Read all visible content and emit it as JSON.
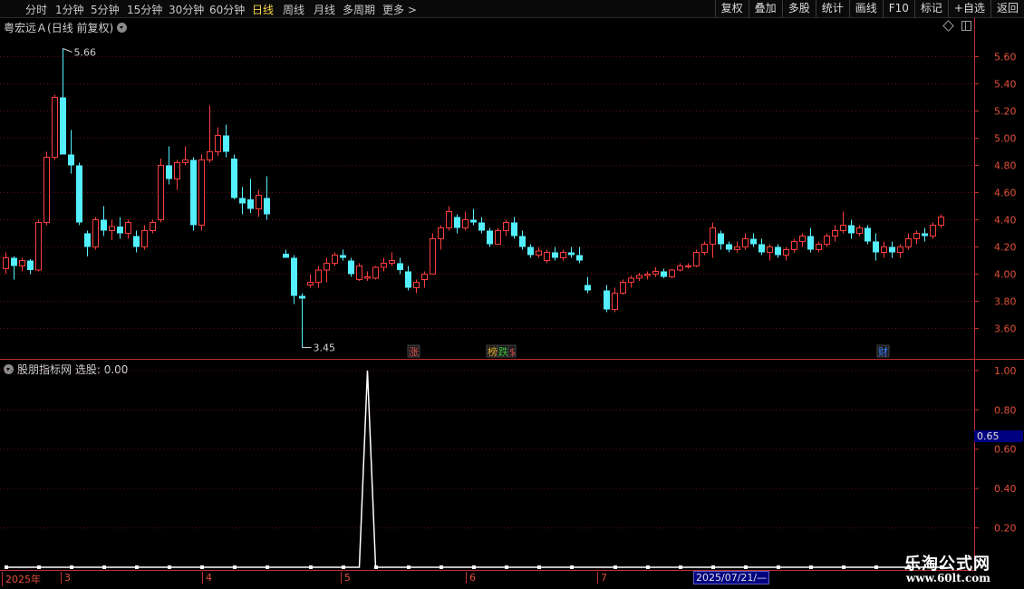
{
  "toolbar": {
    "periods": [
      "分时",
      "1分钟",
      "5分钟",
      "15分钟",
      "30分钟",
      "60分钟",
      "日线",
      "周线",
      "月线",
      "多周期",
      "更多 >"
    ],
    "active_period": "日线",
    "right": [
      "复权",
      "叠加",
      "多股",
      "统计",
      "画线",
      "F10",
      "标记",
      "+自选",
      "返回"
    ]
  },
  "main_panel": {
    "stock_name": "粤宏远Ａ",
    "mode": "(日线 前复权)",
    "ylim": [
      3.45,
      5.75
    ],
    "y_ticks": [
      "5.60",
      "5.40",
      "5.20",
      "5.00",
      "4.80",
      "4.60",
      "4.40",
      "4.20",
      "4.00",
      "3.80",
      "3.60"
    ],
    "high_label": "5.66",
    "low_label": "3.45",
    "markers": [
      {
        "text": "涨",
        "color": "#e05050"
      },
      {
        "text": "榜",
        "color": "#e0b030"
      },
      {
        "text": "跌",
        "color": "#40c040"
      },
      {
        "text": "$",
        "color": "#e05050"
      },
      {
        "text": "财",
        "color": "#4080ff"
      }
    ]
  },
  "sub_panel": {
    "indicator": "股朋指标网",
    "value_label": "选股: 0.00",
    "y_ticks": [
      "1.00",
      "0.80",
      "0.60",
      "0.40",
      "0.20"
    ],
    "cursor_value": "0.65"
  },
  "time_axis": {
    "labels": [
      "2025年",
      "3",
      "4",
      "5",
      "6",
      "7"
    ],
    "cursor_date": "2025/07/21/—"
  },
  "watermark": {
    "title": "乐淘公式网",
    "url": "www.60lt.com"
  },
  "colors": {
    "up": "#ff3d3d",
    "down": "#54f0ff",
    "axis": "#c03030",
    "background": "#000000"
  },
  "chart_data": {
    "type": "candlestick",
    "ohlc": [
      [
        4.04,
        4.16,
        4.0,
        4.12
      ],
      [
        4.12,
        4.13,
        3.96,
        4.06
      ],
      [
        4.06,
        4.12,
        4.02,
        4.1
      ],
      [
        4.1,
        4.11,
        4.0,
        4.03
      ],
      [
        4.03,
        4.4,
        4.02,
        4.38
      ],
      [
        4.38,
        4.9,
        4.36,
        4.86
      ],
      [
        4.86,
        5.32,
        4.84,
        5.3
      ],
      [
        5.3,
        5.66,
        4.9,
        4.88
      ],
      [
        4.88,
        5.06,
        4.74,
        4.8
      ],
      [
        4.8,
        4.82,
        4.36,
        4.38
      ],
      [
        4.3,
        4.32,
        4.13,
        4.2
      ],
      [
        4.2,
        4.42,
        4.18,
        4.4
      ],
      [
        4.4,
        4.5,
        4.28,
        4.32
      ],
      [
        4.32,
        4.4,
        4.25,
        4.35
      ],
      [
        4.35,
        4.42,
        4.26,
        4.3
      ],
      [
        4.3,
        4.4,
        4.26,
        4.38
      ],
      [
        4.28,
        4.32,
        4.16,
        4.2
      ],
      [
        4.2,
        4.36,
        4.18,
        4.32
      ],
      [
        4.32,
        4.4,
        4.3,
        4.38
      ],
      [
        4.4,
        4.85,
        4.38,
        4.8
      ],
      [
        4.8,
        4.94,
        4.66,
        4.7
      ],
      [
        4.7,
        4.84,
        4.62,
        4.82
      ],
      [
        4.82,
        4.94,
        4.8,
        4.84
      ],
      [
        4.84,
        4.86,
        4.32,
        4.36
      ],
      [
        4.36,
        4.88,
        4.32,
        4.84
      ],
      [
        4.84,
        5.24,
        4.82,
        4.9
      ],
      [
        4.9,
        5.08,
        4.87,
        5.02
      ],
      [
        5.02,
        5.1,
        4.86,
        4.9
      ],
      [
        4.85,
        4.88,
        4.55,
        4.56
      ],
      [
        4.56,
        4.64,
        4.44,
        4.52
      ],
      [
        4.55,
        4.7,
        4.45,
        4.48
      ],
      [
        4.48,
        4.62,
        4.42,
        4.58
      ],
      [
        4.56,
        4.72,
        4.4,
        4.44
      ],
      [
        4.15,
        4.18,
        4.12,
        4.12
      ],
      [
        4.12,
        4.14,
        3.78,
        3.84
      ],
      [
        3.84,
        3.86,
        3.46,
        3.82
      ],
      [
        3.92,
        4.0,
        3.9,
        3.94
      ],
      [
        3.94,
        4.06,
        3.9,
        4.03
      ],
      [
        4.03,
        4.12,
        3.94,
        4.08
      ],
      [
        4.08,
        4.16,
        4.06,
        4.14
      ],
      [
        4.14,
        4.18,
        4.1,
        4.12
      ],
      [
        4.1,
        4.12,
        3.98,
        4.0
      ],
      [
        3.96,
        4.08,
        3.95,
        4.06
      ],
      [
        3.97,
        4.02,
        3.95,
        3.98
      ],
      [
        3.97,
        4.06,
        3.96,
        4.05
      ],
      [
        4.05,
        4.12,
        4.02,
        4.08
      ],
      [
        4.08,
        4.16,
        4.06,
        4.1
      ],
      [
        4.08,
        4.12,
        4.0,
        4.03
      ],
      [
        4.02,
        4.06,
        3.88,
        3.9
      ],
      [
        3.9,
        3.96,
        3.86,
        3.94
      ],
      [
        3.96,
        4.02,
        3.9,
        4.0
      ],
      [
        4.0,
        4.3,
        4.18,
        4.26
      ],
      [
        4.26,
        4.36,
        4.18,
        4.34
      ],
      [
        4.34,
        4.5,
        4.32,
        4.46
      ],
      [
        4.42,
        4.44,
        4.3,
        4.34
      ],
      [
        4.34,
        4.46,
        4.32,
        4.4
      ],
      [
        4.4,
        4.48,
        4.36,
        4.38
      ],
      [
        4.38,
        4.42,
        4.3,
        4.32
      ],
      [
        4.32,
        4.34,
        4.2,
        4.22
      ],
      [
        4.22,
        4.34,
        4.22,
        4.32
      ],
      [
        4.32,
        4.4,
        4.28,
        4.38
      ],
      [
        4.38,
        4.42,
        4.26,
        4.28
      ],
      [
        4.28,
        4.32,
        4.18,
        4.2
      ],
      [
        4.2,
        4.22,
        4.12,
        4.14
      ],
      [
        4.14,
        4.2,
        4.12,
        4.17
      ],
      [
        4.1,
        4.18,
        4.08,
        4.16
      ],
      [
        4.16,
        4.2,
        4.1,
        4.12
      ],
      [
        4.12,
        4.18,
        4.1,
        4.16
      ],
      [
        4.16,
        4.2,
        4.12,
        4.14
      ],
      [
        4.14,
        4.2,
        4.08,
        4.1
      ],
      [
        3.92,
        3.98,
        3.86,
        3.88
      ],
      [
        3.88,
        3.92,
        3.72,
        3.74
      ],
      [
        3.74,
        3.9,
        3.72,
        3.86
      ],
      [
        3.86,
        3.96,
        3.85,
        3.94
      ],
      [
        3.94,
        3.99,
        3.9,
        3.97
      ],
      [
        3.97,
        4.01,
        3.95,
        3.99
      ],
      [
        3.99,
        4.02,
        3.96,
        4.0
      ],
      [
        4.0,
        4.05,
        3.98,
        4.02
      ],
      [
        4.02,
        4.04,
        3.97,
        3.98
      ],
      [
        3.98,
        4.04,
        3.97,
        4.03
      ],
      [
        4.03,
        4.08,
        4.02,
        4.06
      ],
      [
        4.06,
        4.08,
        4.04,
        4.06
      ],
      [
        4.06,
        4.18,
        4.05,
        4.16
      ],
      [
        4.16,
        4.24,
        4.14,
        4.22
      ],
      [
        4.22,
        4.38,
        4.12,
        4.34
      ],
      [
        4.3,
        4.32,
        4.18,
        4.22
      ],
      [
        4.22,
        4.24,
        4.16,
        4.18
      ],
      [
        4.18,
        4.24,
        4.16,
        4.2
      ],
      [
        4.2,
        4.3,
        4.18,
        4.26
      ],
      [
        4.26,
        4.3,
        4.2,
        4.22
      ],
      [
        4.22,
        4.26,
        4.14,
        4.16
      ],
      [
        4.16,
        4.22,
        4.1,
        4.2
      ],
      [
        4.2,
        4.22,
        4.12,
        4.14
      ],
      [
        4.14,
        4.2,
        4.1,
        4.18
      ],
      [
        4.18,
        4.26,
        4.16,
        4.24
      ],
      [
        4.24,
        4.3,
        4.2,
        4.28
      ],
      [
        4.28,
        4.34,
        4.16,
        4.18
      ],
      [
        4.18,
        4.24,
        4.16,
        4.22
      ],
      [
        4.22,
        4.3,
        4.2,
        4.28
      ],
      [
        4.28,
        4.36,
        4.24,
        4.32
      ],
      [
        4.32,
        4.46,
        4.3,
        4.36
      ],
      [
        4.36,
        4.4,
        4.26,
        4.3
      ],
      [
        4.3,
        4.36,
        4.28,
        4.34
      ],
      [
        4.34,
        4.36,
        4.22,
        4.24
      ],
      [
        4.24,
        4.3,
        4.1,
        4.16
      ],
      [
        4.16,
        4.24,
        4.12,
        4.2
      ],
      [
        4.2,
        4.24,
        4.12,
        4.16
      ],
      [
        4.16,
        4.22,
        4.12,
        4.2
      ],
      [
        4.2,
        4.3,
        4.18,
        4.26
      ],
      [
        4.26,
        4.32,
        4.22,
        4.3
      ],
      [
        4.3,
        4.34,
        4.24,
        4.28
      ],
      [
        4.28,
        4.38,
        4.26,
        4.36
      ],
      [
        4.36,
        4.44,
        4.34,
        4.42
      ]
    ],
    "indicator_name": "选股",
    "indicator_peak_index": 43,
    "indicator_peak_value": 1.0,
    "indicator_ylim": [
      0,
      1.05
    ]
  }
}
